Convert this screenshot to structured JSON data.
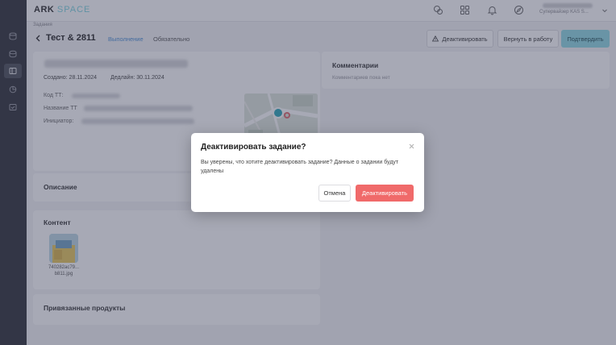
{
  "app": {
    "logo_main": "ARK",
    "logo_accent": "SPACE"
  },
  "user": {
    "name": "Супервайзер KAS S..."
  },
  "breadcrumb": "Задания",
  "page": {
    "title": "Тест & 2811"
  },
  "tabs": {
    "execution": "Выполнение",
    "required": "Обязательно"
  },
  "toolbar": {
    "deactivate": "Деактивировать",
    "return": "Вернуть в работу",
    "confirm": "Подтвердить"
  },
  "task": {
    "created": "Создано: 28.11.2024",
    "deadline": "Дедлайн: 30.11.2024",
    "code_label": "Код ТТ:",
    "name_label": "Название ТТ",
    "initiator_label": "Инициатор:"
  },
  "sections": {
    "description": "Описание",
    "content": "Контент",
    "products": "Привязанные продукты"
  },
  "attachment": {
    "filename": "740282ac79... b811.jpg"
  },
  "comments": {
    "title": "Комментарии",
    "empty": "Комментариев пока нет"
  },
  "modal": {
    "title": "Деактивировать задание?",
    "text": "Вы уверены, что хотите деактивировать задание? Данные о задании будут удалены",
    "cancel": "Отмена",
    "confirm": "Деактивировать"
  },
  "colors": {
    "accent": "#8fd9e3",
    "danger": "#f06a6a",
    "link": "#4a8fd6",
    "sidebar": "#2d2f36"
  }
}
